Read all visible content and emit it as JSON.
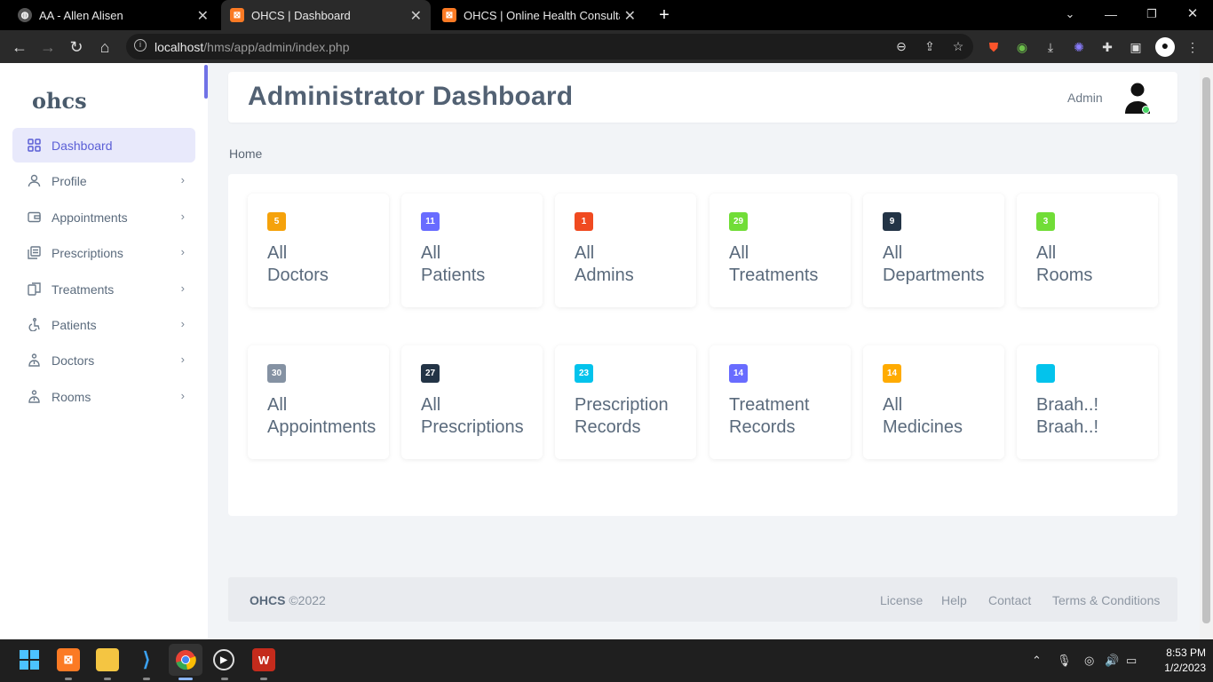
{
  "browser": {
    "tabs": [
      {
        "title": "AA - Allen Alisen",
        "active": false
      },
      {
        "title": "OHCS | Dashboard",
        "active": true
      },
      {
        "title": "OHCS | Online Health Consultatio",
        "active": false
      }
    ],
    "url_host": "localhost",
    "url_path": "/hms/app/admin/index.php"
  },
  "sidebar": {
    "brand": "ohcs",
    "items": [
      {
        "label": "Dashboard",
        "icon": "grid-icon",
        "active": true
      },
      {
        "label": "Profile",
        "icon": "user-icon"
      },
      {
        "label": "Appointments",
        "icon": "wallet-icon"
      },
      {
        "label": "Prescriptions",
        "icon": "copy-icon"
      },
      {
        "label": "Treatments",
        "icon": "pages-icon"
      },
      {
        "label": "Patients",
        "icon": "accessibility-icon"
      },
      {
        "label": "Doctors",
        "icon": "doctor-icon"
      },
      {
        "label": "Rooms",
        "icon": "doctor-icon"
      }
    ]
  },
  "header": {
    "title": "Administrator Dashboard",
    "user": "Admin"
  },
  "breadcrumb": "Home",
  "cards": [
    {
      "count": "5",
      "line1": "All",
      "line2": "Doctors",
      "color": "#f5a20b"
    },
    {
      "count": "11",
      "line1": "All",
      "line2": "Patients",
      "color": "#696cff"
    },
    {
      "count": "1",
      "line1": "All",
      "line2": "Admins",
      "color": "#f04a20"
    },
    {
      "count": "29",
      "line1": "All",
      "line2": "Treatments",
      "color": "#71dd37"
    },
    {
      "count": "9",
      "line1": "All",
      "line2": "Departments",
      "color": "#233446"
    },
    {
      "count": "3",
      "line1": "All",
      "line2": "Rooms",
      "color": "#71dd37"
    },
    {
      "count": "30",
      "line1": "All",
      "line2": "Appointments",
      "color": "#8592a3"
    },
    {
      "count": "27",
      "line1": "All",
      "line2": "Prescriptions",
      "color": "#233446"
    },
    {
      "count": "23",
      "line1": "Prescription",
      "line2": "Records",
      "color": "#03c3ec"
    },
    {
      "count": "14",
      "line1": "Treatment",
      "line2": "Records",
      "color": "#696cff"
    },
    {
      "count": "14",
      "line1": "All",
      "line2": "Medicines",
      "color": "#ffab00"
    },
    {
      "count": "",
      "line1": "Braah..!",
      "line2": "Braah..!",
      "color": "#03c3ec"
    }
  ],
  "footer": {
    "brand": "OHCS",
    "year": "©2022",
    "links": [
      "License",
      "Help",
      "Contact",
      "Terms & Conditions"
    ]
  },
  "taskbar": {
    "time": "8:53 PM",
    "date": "1/2/2023"
  }
}
